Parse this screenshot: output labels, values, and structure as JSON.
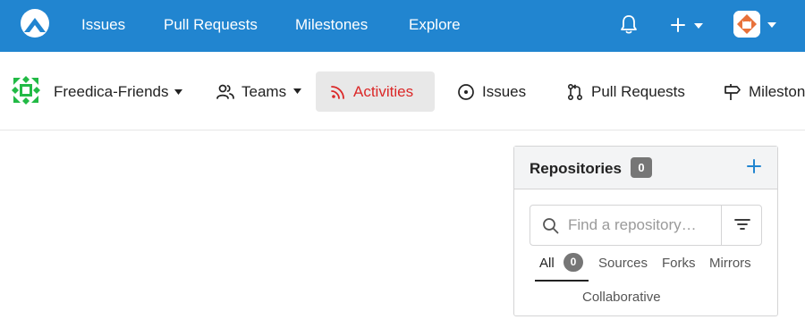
{
  "topnav": {
    "links": [
      "Issues",
      "Pull Requests",
      "Milestones",
      "Explore"
    ],
    "background": "#2185d0"
  },
  "org": {
    "name": "Freedica-Friends",
    "avatar_color": "#21ba45"
  },
  "tabs": {
    "teams": "Teams",
    "activities": "Activities",
    "issues": "Issues",
    "pulls": "Pull Requests",
    "milestones": "Milestones",
    "active_color": "#db2828"
  },
  "repositories": {
    "title": "Repositories",
    "count": "0",
    "search_placeholder": "Find a repository…",
    "tabs": {
      "all": "All",
      "all_count": "0",
      "sources": "Sources",
      "forks": "Forks",
      "mirrors": "Mirrors",
      "collaborative": "Collaborative"
    }
  },
  "icons": [
    "logo-icon",
    "bell-icon",
    "plus-icon",
    "caret-down-icon",
    "user-avatar",
    "org-avatar",
    "people-icon",
    "rss-icon",
    "issue-opened-icon",
    "git-pull-request-icon",
    "milestone-icon",
    "search-icon",
    "filter-icon"
  ]
}
